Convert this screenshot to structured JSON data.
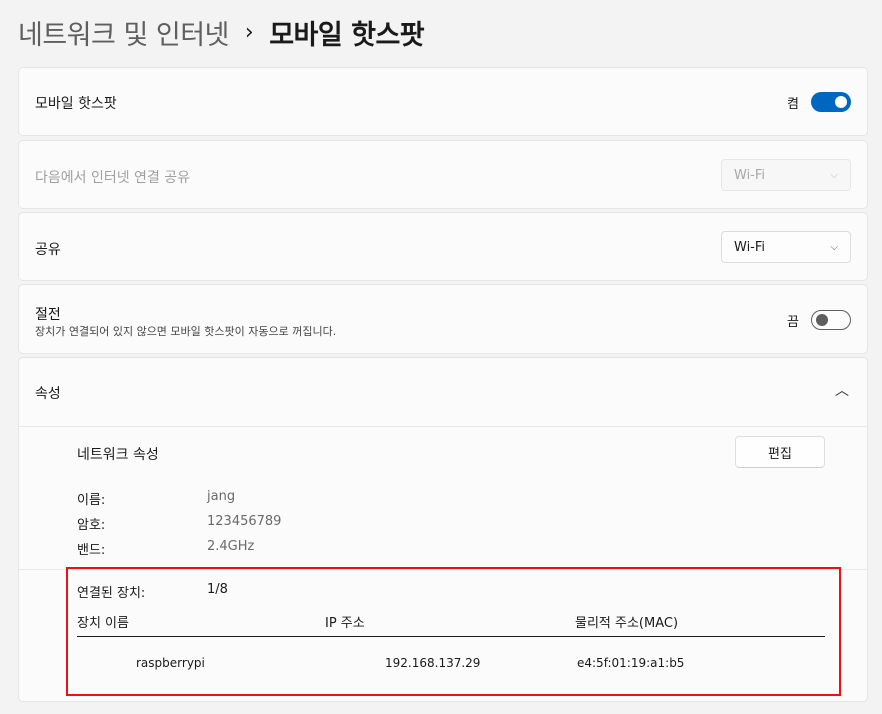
{
  "breadcrumb": {
    "parent": "네트워크 및 인터넷",
    "separator": "›",
    "current": "모바일 핫스팟"
  },
  "hotspot": {
    "label": "모바일 핫스팟",
    "state_label": "켬",
    "enabled": true
  },
  "share_from": {
    "label": "다음에서 인터넷 연결 공유",
    "value": "Wi-Fi",
    "disabled": true
  },
  "share_over": {
    "label": "공유",
    "value": "Wi-Fi"
  },
  "power_saving": {
    "label": "절전",
    "description": "장치가 연결되어 있지 않으면 모바일 핫스팟이 자동으로 꺼집니다.",
    "state_label": "끔",
    "enabled": false
  },
  "properties": {
    "label": "속성",
    "network_properties_label": "네트워크 속성",
    "edit_label": "편집",
    "fields": [
      {
        "label": "이름:",
        "value": "jang"
      },
      {
        "label": "암호:",
        "value": "123456789"
      },
      {
        "label": "밴드:",
        "value": "2.4GHz"
      }
    ],
    "connected_label": "연결된 장치:",
    "connected_value": "1/8",
    "columns": [
      "장치 이름",
      "IP 주소",
      "물리적 주소(MAC)"
    ],
    "devices": [
      {
        "name": "raspberrypi",
        "ip": "192.168.137.29",
        "mac": "e4:5f:01:19:a1:b5"
      }
    ]
  },
  "colors": {
    "accent": "#0067c0",
    "highlight": "#e11111"
  },
  "icons": {
    "chevron_down": "chevron-down-icon",
    "chevron_up": "chevron-up-icon"
  }
}
